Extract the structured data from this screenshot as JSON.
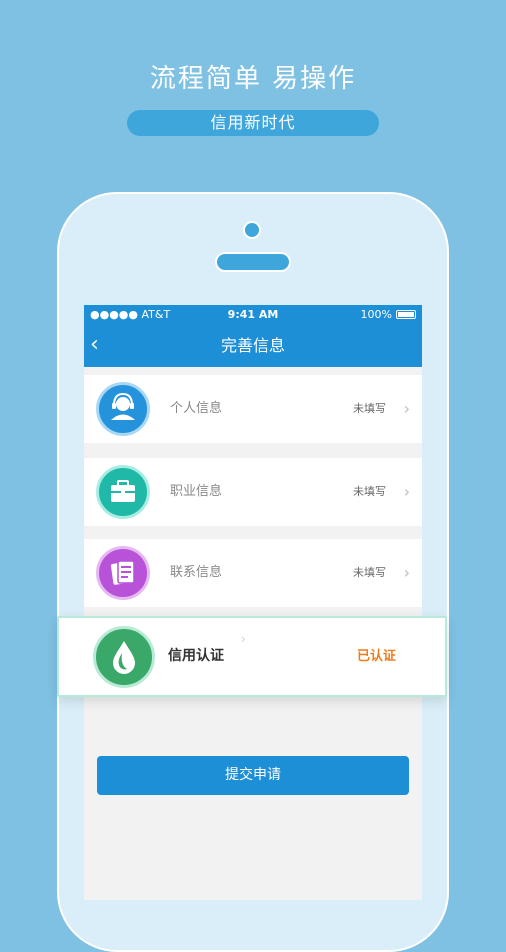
{
  "promo": {
    "headline": "流程简单 易操作",
    "tagline": "信用新时代"
  },
  "statusbar": {
    "carrier": "●●●●● AT&T",
    "time": "9:41 AM",
    "battery": "100%"
  },
  "navbar": {
    "back": "‹",
    "title": "完善信息"
  },
  "items": [
    {
      "label": "个人信息",
      "status": "未填写",
      "icon": "customer-service-icon",
      "color": "#2592dc"
    },
    {
      "label": "职业信息",
      "status": "未填写",
      "icon": "briefcase-icon",
      "color": "#20b8a7"
    },
    {
      "label": "联系信息",
      "status": "未填写",
      "icon": "contacts-icon",
      "color": "#b752d9"
    }
  ],
  "credit": {
    "label": "信用认证",
    "status": "已认证",
    "icon": "water-drop-icon",
    "color": "#3aa868",
    "status_color": "#ee7c1a"
  },
  "submit_label": "提交申请",
  "colors": {
    "background": "#7fc1e3",
    "primary": "#1d8fd6"
  }
}
